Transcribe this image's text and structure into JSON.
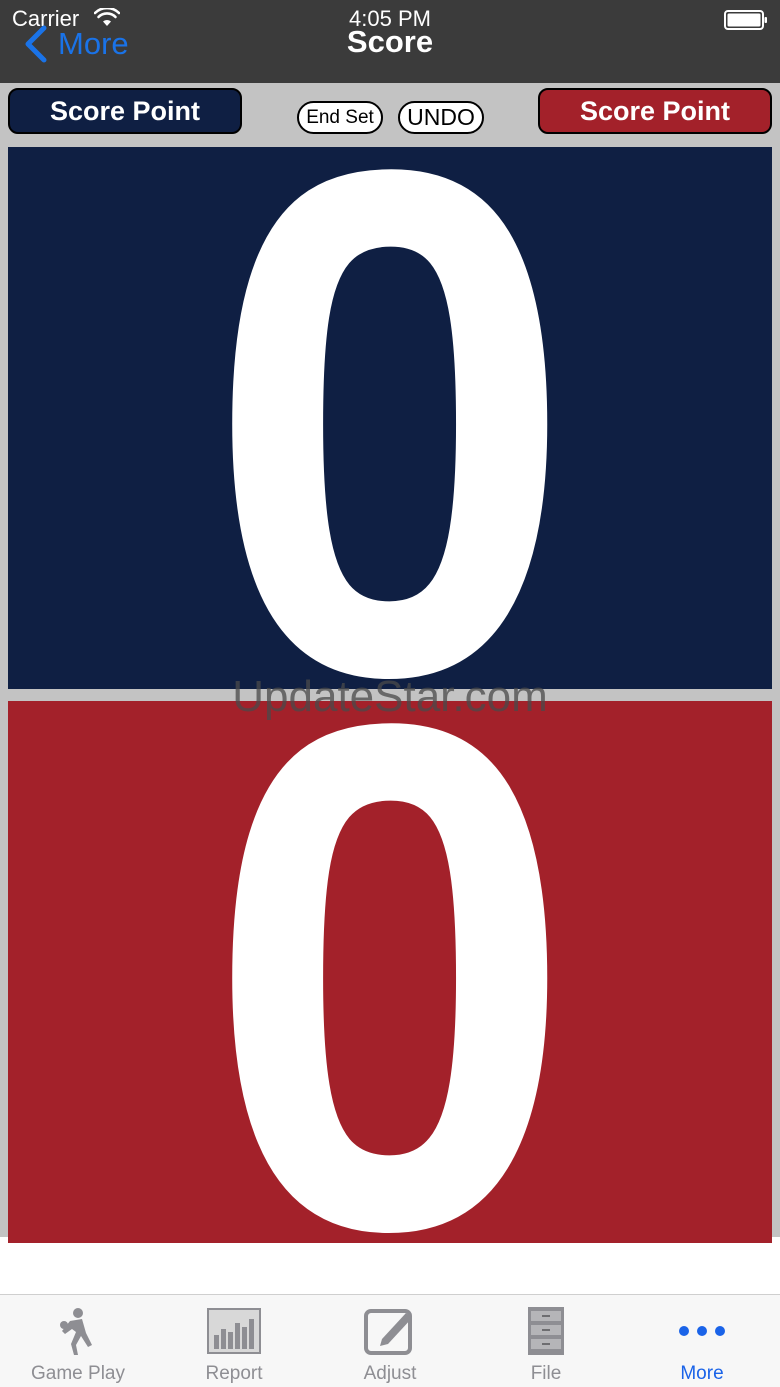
{
  "status_bar": {
    "carrier": "Carrier",
    "time": "4:05 PM"
  },
  "nav": {
    "back_label": "More",
    "title": "Score"
  },
  "controls": {
    "home_score_button": "Score Point",
    "away_score_button": "Score Point",
    "end_set": "End Set",
    "undo": "UNDO"
  },
  "scores": {
    "home": "0",
    "away": "0"
  },
  "watermark": "UpdateStar.com",
  "tabs": [
    {
      "label": "Game Play",
      "icon": "player-icon"
    },
    {
      "label": "Report",
      "icon": "bar-chart-icon"
    },
    {
      "label": "Adjust",
      "icon": "edit-icon"
    },
    {
      "label": "File",
      "icon": "file-cabinet-icon"
    },
    {
      "label": "More",
      "icon": "more-dots-icon",
      "active": true
    }
  ],
  "colors": {
    "home": "#0f1f43",
    "away": "#a3212a",
    "accent": "#1a63e8"
  }
}
